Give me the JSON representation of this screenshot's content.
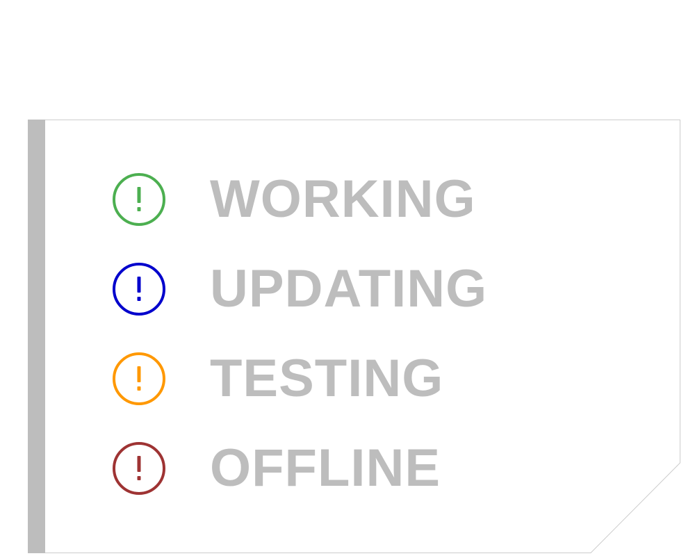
{
  "colors": {
    "accent_bar": "#bdbdbd",
    "border": "#cccccc",
    "label_text": "#bdbdbd"
  },
  "statuses": [
    {
      "label": "WORKING",
      "icon": "alert-circle-icon",
      "color": "#4caf50"
    },
    {
      "label": "UPDATING",
      "icon": "alert-circle-icon",
      "color": "#0000cc"
    },
    {
      "label": "TESTING",
      "icon": "alert-circle-icon",
      "color": "#ff9800"
    },
    {
      "label": "OFFLINE",
      "icon": "alert-circle-icon",
      "color": "#9e3333"
    }
  ]
}
